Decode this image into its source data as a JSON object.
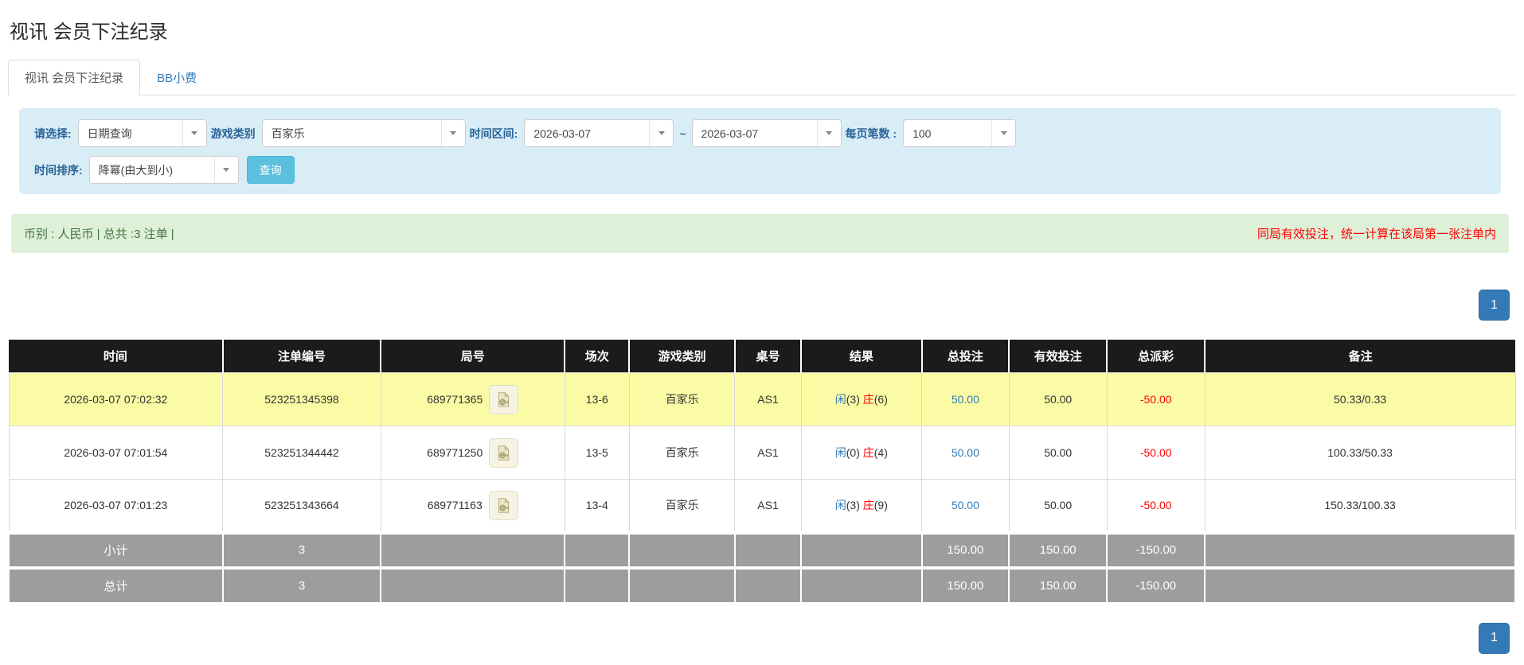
{
  "page_title": "视讯 会员下注纪录",
  "tabs": {
    "active_label": "视讯 会员下注纪录",
    "bb_tip_label": "BB小费"
  },
  "filters": {
    "mode_label": "请选择:",
    "mode_value": "日期查询",
    "game_label": "游戏类别",
    "game_value": "百家乐",
    "range_label": "时间区间:",
    "date_from": "2026-03-07",
    "date_separator": "~",
    "date_to": "2026-03-07",
    "page_size_label": "每页笔数 :",
    "page_size_value": "100",
    "sort_label": "时间排序:",
    "sort_value": "降幂(由大到小)",
    "search_label": "查询"
  },
  "notice_bar": {
    "left_text": "币别 : 人民币 | 总共 :3 注单 |",
    "right_text": "同局有效投注，统一计算在该局第一张注单内"
  },
  "pagination": {
    "current_page": "1"
  },
  "table": {
    "headers": [
      "时间",
      "注单编号",
      "局号",
      "场次",
      "游戏类别",
      "桌号",
      "结果",
      "总投注",
      "有效投注",
      "总派彩",
      "备注"
    ],
    "rows": [
      {
        "time": "2026-03-07 07:02:32",
        "bet_id": "523251345398",
        "round_id": "689771365",
        "session": "13-6",
        "game_type": "百家乐",
        "table_no": "AS1",
        "result": {
          "player": "闲",
          "player_score": "(3)",
          "banker": "庄",
          "banker_score": "(6)"
        },
        "total_bet": "50.00",
        "valid_bet": "50.00",
        "payout": "-50.00",
        "remark": "50.33/0.33"
      },
      {
        "time": "2026-03-07 07:01:54",
        "bet_id": "523251344442",
        "round_id": "689771250",
        "session": "13-5",
        "game_type": "百家乐",
        "table_no": "AS1",
        "result": {
          "player": "闲",
          "player_score": "(0)",
          "banker": "庄",
          "banker_score": "(4)"
        },
        "total_bet": "50.00",
        "valid_bet": "50.00",
        "payout": "-50.00",
        "remark": "100.33/50.33"
      },
      {
        "time": "2026-03-07 07:01:23",
        "bet_id": "523251343664",
        "round_id": "689771163",
        "session": "13-4",
        "game_type": "百家乐",
        "table_no": "AS1",
        "result": {
          "player": "闲",
          "player_score": "(3)",
          "banker": "庄",
          "banker_score": "(9)"
        },
        "total_bet": "50.00",
        "valid_bet": "50.00",
        "payout": "-50.00",
        "remark": "150.33/100.33"
      }
    ],
    "subtotal_row": {
      "label": "小计",
      "count": "3",
      "total_bet": "150.00",
      "valid_bet": "150.00",
      "payout": "-150.00"
    },
    "total_row": {
      "label": "总计",
      "count": "3",
      "total_bet": "150.00",
      "valid_bet": "150.00",
      "payout": "-150.00"
    }
  },
  "colors": {
    "accent_blue": "#337ab7",
    "filter_panel_bg": "#d9edf7",
    "notice_bg": "#dff0d8",
    "notice_text": "#3c763d",
    "negative_red": "#ff0000",
    "highlight_yellow": "#fbfba6",
    "table_header_bg": "#1b1b1b",
    "summary_row_bg": "#9d9d9d",
    "search_button_bg": "#5bc0de"
  }
}
